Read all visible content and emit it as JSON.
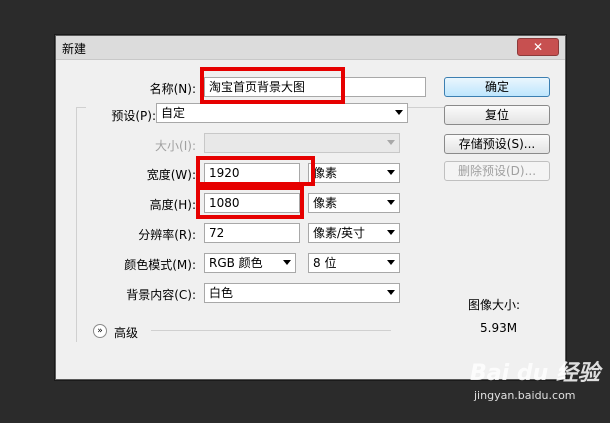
{
  "dialog": {
    "title": "新建",
    "close_icon": "close-icon"
  },
  "form": {
    "name_label": "名称(N):",
    "name_value": "淘宝首页背景大图",
    "preset_label": "预设(P):",
    "preset_value": "自定",
    "size_label": "大小(I):",
    "size_value": "",
    "width_label": "宽度(W):",
    "width_value": "1920",
    "width_unit": "像素",
    "height_label": "高度(H):",
    "height_value": "1080",
    "height_unit": "像素",
    "resolution_label": "分辨率(R):",
    "resolution_value": "72",
    "resolution_unit": "像素/英寸",
    "color_mode_label": "颜色模式(M):",
    "color_mode_value": "RGB 颜色",
    "bit_depth_value": "8 位",
    "background_label": "背景内容(C):",
    "background_value": "白色",
    "advanced_label": "高级"
  },
  "buttons": {
    "ok": "确定",
    "reset": "复位",
    "save_preset": "存储预设(S)...",
    "delete_preset": "删除预设(D)..."
  },
  "image_size": {
    "label": "图像大小:",
    "value": "5.93M"
  },
  "watermark": {
    "logo": "Bai du 经验",
    "url": "jingyan.baidu.com"
  },
  "colors": {
    "highlight_red": "#e60000",
    "primary_button": "#bee6fd"
  }
}
